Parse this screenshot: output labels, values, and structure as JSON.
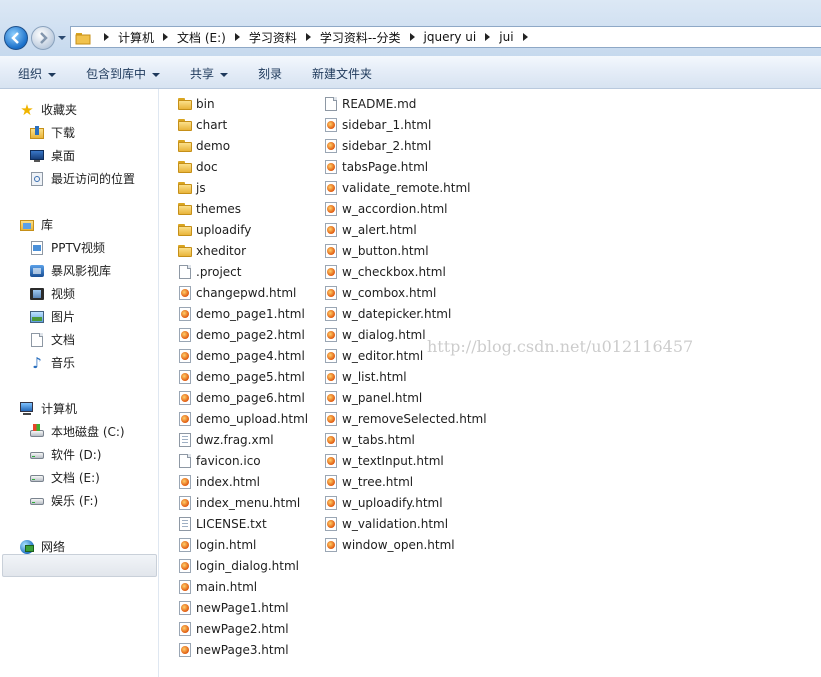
{
  "address": {
    "crumbs": [
      "计算机",
      "文档 (E:)",
      "学习资料",
      "学习资料--分类",
      "jquery ui",
      "jui"
    ]
  },
  "toolbar": {
    "organize": "组织",
    "include_in_library": "包含到库中",
    "share": "共享",
    "burn": "刻录",
    "new_folder": "新建文件夹"
  },
  "nav": {
    "favorites": "收藏夹",
    "downloads": "下载",
    "desktop": "桌面",
    "recent": "最近访问的位置",
    "libraries": "库",
    "pptv": "PPTV视频",
    "storm": "暴风影视库",
    "videos": "视频",
    "pictures": "图片",
    "documents": "文档",
    "music": "音乐",
    "computer": "计算机",
    "drive_c": "本地磁盘 (C:)",
    "drive_d": "软件 (D:)",
    "drive_e": "文档 (E:)",
    "drive_f": "娱乐 (F:)",
    "network": "网络"
  },
  "files": {
    "column1": [
      {
        "name": "bin",
        "icon": "folder-icon"
      },
      {
        "name": "chart",
        "icon": "folder-icon"
      },
      {
        "name": "demo",
        "icon": "folder-icon"
      },
      {
        "name": "doc",
        "icon": "folder-icon"
      },
      {
        "name": "js",
        "icon": "folder-icon"
      },
      {
        "name": "themes",
        "icon": "folder-icon"
      },
      {
        "name": "uploadify",
        "icon": "folder-icon"
      },
      {
        "name": "xheditor",
        "icon": "folder-icon"
      },
      {
        "name": ".project",
        "icon": "document-icon"
      },
      {
        "name": "changepwd.html",
        "icon": "html-file-icon"
      },
      {
        "name": "demo_page1.html",
        "icon": "html-file-icon"
      },
      {
        "name": "demo_page2.html",
        "icon": "html-file-icon"
      },
      {
        "name": "demo_page4.html",
        "icon": "html-file-icon"
      },
      {
        "name": "demo_page5.html",
        "icon": "html-file-icon"
      },
      {
        "name": "demo_page6.html",
        "icon": "html-file-icon"
      },
      {
        "name": "demo_upload.html",
        "icon": "html-file-icon"
      },
      {
        "name": "dwz.frag.xml",
        "icon": "xml-file-icon"
      },
      {
        "name": "favicon.ico",
        "icon": "document-icon"
      },
      {
        "name": "index.html",
        "icon": "html-file-icon"
      },
      {
        "name": "index_menu.html",
        "icon": "html-file-icon"
      },
      {
        "name": "LICENSE.txt",
        "icon": "text-file-icon"
      },
      {
        "name": "login.html",
        "icon": "html-file-icon"
      },
      {
        "name": "login_dialog.html",
        "icon": "html-file-icon"
      },
      {
        "name": "main.html",
        "icon": "html-file-icon"
      },
      {
        "name": "newPage1.html",
        "icon": "html-file-icon"
      },
      {
        "name": "newPage2.html",
        "icon": "html-file-icon"
      },
      {
        "name": "newPage3.html",
        "icon": "html-file-icon"
      }
    ],
    "column2": [
      {
        "name": "README.md",
        "icon": "document-icon"
      },
      {
        "name": "sidebar_1.html",
        "icon": "html-file-icon"
      },
      {
        "name": "sidebar_2.html",
        "icon": "html-file-icon"
      },
      {
        "name": "tabsPage.html",
        "icon": "html-file-icon"
      },
      {
        "name": "validate_remote.html",
        "icon": "html-file-icon"
      },
      {
        "name": "w_accordion.html",
        "icon": "html-file-icon"
      },
      {
        "name": "w_alert.html",
        "icon": "html-file-icon"
      },
      {
        "name": "w_button.html",
        "icon": "html-file-icon"
      },
      {
        "name": "w_checkbox.html",
        "icon": "html-file-icon"
      },
      {
        "name": "w_combox.html",
        "icon": "html-file-icon"
      },
      {
        "name": "w_datepicker.html",
        "icon": "html-file-icon"
      },
      {
        "name": "w_dialog.html",
        "icon": "html-file-icon"
      },
      {
        "name": "w_editor.html",
        "icon": "html-file-icon"
      },
      {
        "name": "w_list.html",
        "icon": "html-file-icon"
      },
      {
        "name": "w_panel.html",
        "icon": "html-file-icon"
      },
      {
        "name": "w_removeSelected.html",
        "icon": "html-file-icon"
      },
      {
        "name": "w_tabs.html",
        "icon": "html-file-icon"
      },
      {
        "name": "w_textInput.html",
        "icon": "html-file-icon"
      },
      {
        "name": "w_tree.html",
        "icon": "html-file-icon"
      },
      {
        "name": "w_uploadify.html",
        "icon": "html-file-icon"
      },
      {
        "name": "w_validation.html",
        "icon": "html-file-icon"
      },
      {
        "name": "window_open.html",
        "icon": "html-file-icon"
      }
    ]
  },
  "watermark": "http://blog.csdn.net/u012116457",
  "colors": {
    "toolbar_text": "#1e395b",
    "selection_bg": "#e2e6ec"
  }
}
